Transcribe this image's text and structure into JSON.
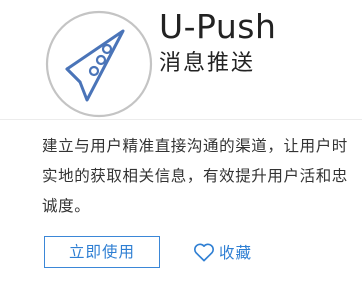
{
  "app": {
    "title": "U-Push",
    "subtitle": "消息推送"
  },
  "description": "建立与用户精准直接沟通的渠道，让用户时实地的获取相关信息，有效提升用户活和忠诚度。",
  "actions": {
    "use_label": "立即使用",
    "favorite_label": "收藏"
  },
  "icons": {
    "logo": "paper-plane-icon",
    "favorite": "heart-outline-icon"
  },
  "colors": {
    "accent": "#2f7fd3",
    "logo_stroke": "#4a74b8",
    "logo_ring": "#c4c4c4"
  }
}
